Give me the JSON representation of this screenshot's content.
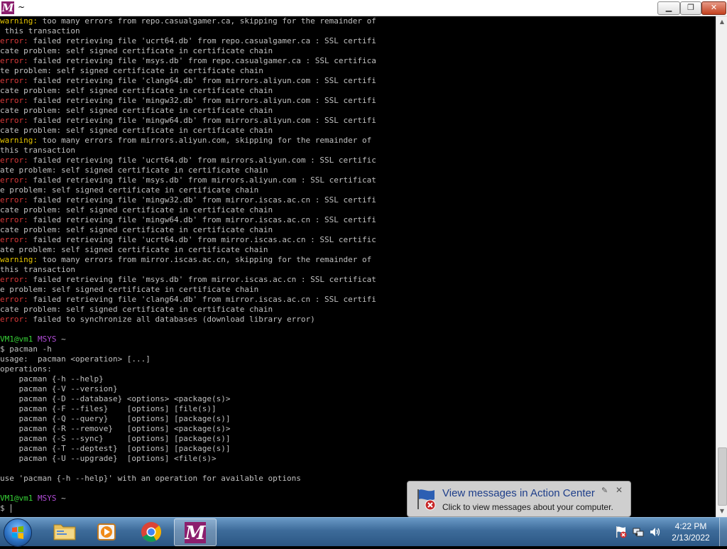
{
  "window": {
    "title": "~",
    "app_icon_letter": "M",
    "min_glyph": "▁",
    "max_glyph": "❐",
    "close_glyph": "✕"
  },
  "terminal": {
    "colors": {
      "text": "#c0c0c0",
      "warning": "#e5c400",
      "error": "#d83a3a",
      "prompt_user": "#37d137",
      "prompt_host": "#b04cd6"
    },
    "lines": [
      {
        "prefix": "warning:",
        "type": "warn",
        "text": " too many errors from repo.casualgamer.ca, skipping for the remainder of"
      },
      {
        "text": " this transaction"
      },
      {
        "prefix": "error:",
        "type": "err",
        "text": " failed retrieving file 'ucrt64.db' from repo.casualgamer.ca : SSL certifi"
      },
      {
        "text": "cate problem: self signed certificate in certificate chain"
      },
      {
        "prefix": "error:",
        "type": "err",
        "text": " failed retrieving file 'msys.db' from repo.casualgamer.ca : SSL certifica"
      },
      {
        "text": "te problem: self signed certificate in certificate chain"
      },
      {
        "prefix": "error:",
        "type": "err",
        "text": " failed retrieving file 'clang64.db' from mirrors.aliyun.com : SSL certifi"
      },
      {
        "text": "cate problem: self signed certificate in certificate chain"
      },
      {
        "prefix": "error:",
        "type": "err",
        "text": " failed retrieving file 'mingw32.db' from mirrors.aliyun.com : SSL certifi"
      },
      {
        "text": "cate problem: self signed certificate in certificate chain"
      },
      {
        "prefix": "error:",
        "type": "err",
        "text": " failed retrieving file 'mingw64.db' from mirrors.aliyun.com : SSL certifi"
      },
      {
        "text": "cate problem: self signed certificate in certificate chain"
      },
      {
        "prefix": "warning:",
        "type": "warn",
        "text": " too many errors from mirrors.aliyun.com, skipping for the remainder of"
      },
      {
        "text": "this transaction"
      },
      {
        "prefix": "error:",
        "type": "err",
        "text": " failed retrieving file 'ucrt64.db' from mirrors.aliyun.com : SSL certific"
      },
      {
        "text": "ate problem: self signed certificate in certificate chain"
      },
      {
        "prefix": "error:",
        "type": "err",
        "text": " failed retrieving file 'msys.db' from mirrors.aliyun.com : SSL certificat"
      },
      {
        "text": "e problem: self signed certificate in certificate chain"
      },
      {
        "prefix": "error:",
        "type": "err",
        "text": " failed retrieving file 'mingw32.db' from mirror.iscas.ac.cn : SSL certifi"
      },
      {
        "text": "cate problem: self signed certificate in certificate chain"
      },
      {
        "prefix": "error:",
        "type": "err",
        "text": " failed retrieving file 'mingw64.db' from mirror.iscas.ac.cn : SSL certifi"
      },
      {
        "text": "cate problem: self signed certificate in certificate chain"
      },
      {
        "prefix": "error:",
        "type": "err",
        "text": " failed retrieving file 'ucrt64.db' from mirror.iscas.ac.cn : SSL certific"
      },
      {
        "text": "ate problem: self signed certificate in certificate chain"
      },
      {
        "prefix": "warning:",
        "type": "warn",
        "text": " too many errors from mirror.iscas.ac.cn, skipping for the remainder of"
      },
      {
        "text": "this transaction"
      },
      {
        "prefix": "error:",
        "type": "err",
        "text": " failed retrieving file 'msys.db' from mirror.iscas.ac.cn : SSL certificat"
      },
      {
        "text": "e problem: self signed certificate in certificate chain"
      },
      {
        "prefix": "error:",
        "type": "err",
        "text": " failed retrieving file 'clang64.db' from mirror.iscas.ac.cn : SSL certifi"
      },
      {
        "text": "cate problem: self signed certificate in certificate chain"
      },
      {
        "prefix": "error:",
        "type": "err",
        "text": " failed to synchronize all databases (download library error)"
      },
      {
        "text": ""
      },
      {
        "prompt": true,
        "user": "VM1@vm1",
        "host": "MSYS",
        "dir": "~"
      },
      {
        "text": "$ pacman -h"
      },
      {
        "text": "usage:  pacman <operation> [...]"
      },
      {
        "text": "operations:"
      },
      {
        "text": "    pacman {-h --help}"
      },
      {
        "text": "    pacman {-V --version}"
      },
      {
        "text": "    pacman {-D --database} <options> <package(s)>"
      },
      {
        "text": "    pacman {-F --files}    [options] [file(s)]"
      },
      {
        "text": "    pacman {-Q --query}    [options] [package(s)]"
      },
      {
        "text": "    pacman {-R --remove}   [options] <package(s)>"
      },
      {
        "text": "    pacman {-S --sync}     [options] [package(s)]"
      },
      {
        "text": "    pacman {-T --deptest}  [options] [package(s)]"
      },
      {
        "text": "    pacman {-U --upgrade}  [options] <file(s)>"
      },
      {
        "text": ""
      },
      {
        "text": "use 'pacman {-h --help}' with an operation for available options"
      },
      {
        "text": ""
      },
      {
        "prompt": true,
        "user": "VM1@vm1",
        "host": "MSYS",
        "dir": "~"
      },
      {
        "text": "$ ",
        "cursor": true
      }
    ]
  },
  "scrollbar": {
    "up_glyph": "▲",
    "down_glyph": "▼"
  },
  "notification": {
    "title": "View messages in Action Center",
    "body": "Click to view messages about your computer.",
    "pin_glyph": "✎",
    "close_glyph": "✕",
    "icon": "action-center-flag-icon"
  },
  "taskbar": {
    "items": [
      {
        "name": "windows-explorer",
        "icon": "folder-icon",
        "active": false
      },
      {
        "name": "windows-media-player",
        "icon": "media-player-icon",
        "active": false
      },
      {
        "name": "google-chrome",
        "icon": "chrome-icon",
        "active": false
      },
      {
        "name": "msys2-terminal",
        "icon": "msys2-icon",
        "active": true
      }
    ],
    "msys2_letter": "M",
    "tray": [
      "action-center-flag-icon",
      "network-icon",
      "volume-icon"
    ],
    "clock": {
      "time": "4:22 PM",
      "date": "2/13/2022"
    }
  }
}
